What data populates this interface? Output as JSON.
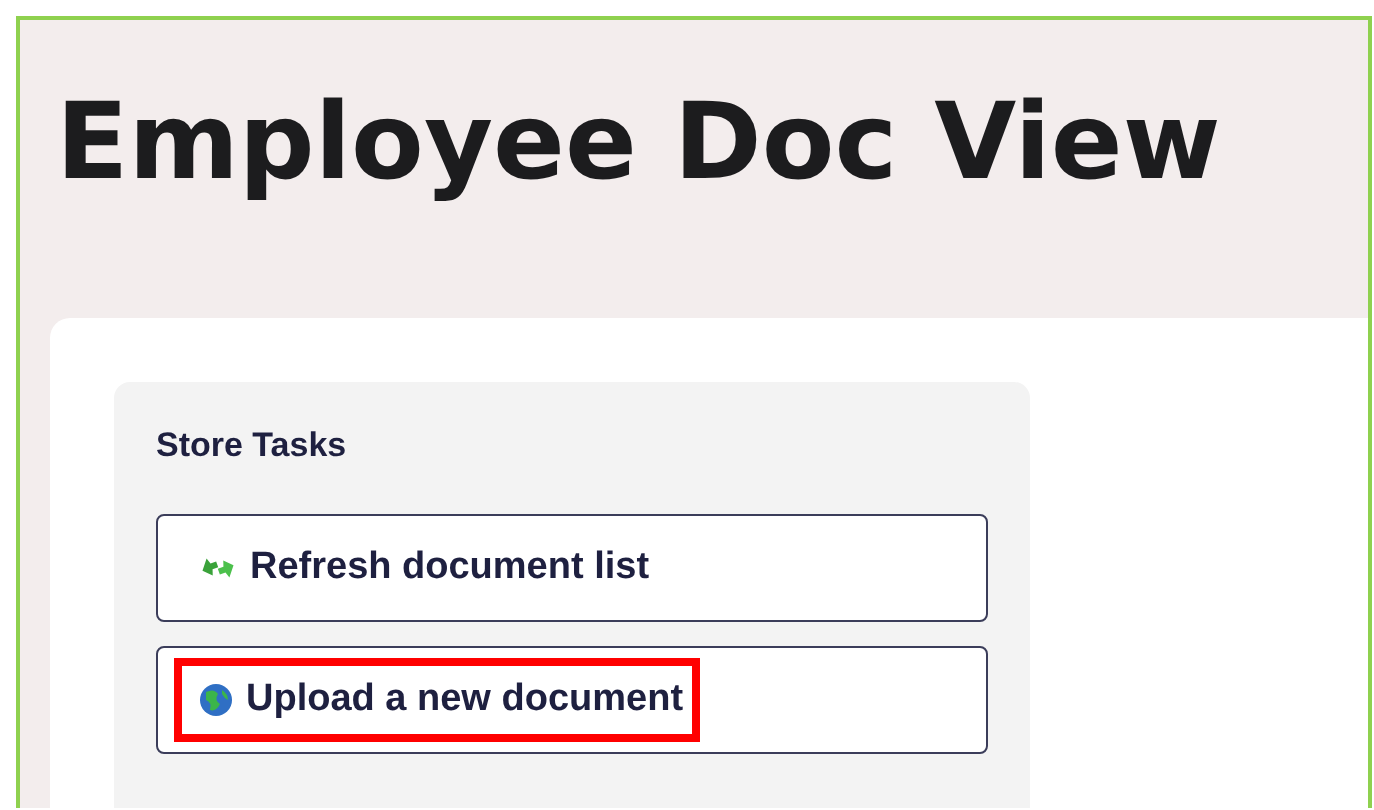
{
  "page": {
    "title": "Employee Doc View"
  },
  "panel": {
    "title": "Store Tasks",
    "tasks": [
      {
        "label": "Refresh document list",
        "kind": "refresh",
        "highlighted": false
      },
      {
        "label": "Upload a new document",
        "kind": "upload",
        "highlighted": true
      }
    ]
  }
}
